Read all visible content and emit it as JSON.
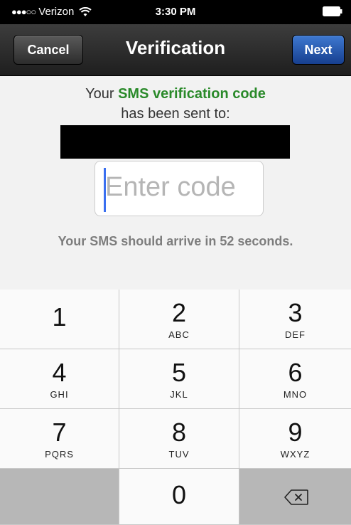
{
  "status": {
    "signal": "●●●○○",
    "carrier": "Verizon",
    "time": "3:30 PM",
    "icons": [
      "wifi-icon",
      "battery-icon"
    ]
  },
  "nav": {
    "cancel_label": "Cancel",
    "title": "Verification",
    "next_label": "Next"
  },
  "message": {
    "line1_prefix": "Your ",
    "line1_highlight": "SMS verification code",
    "line2": "has been sent to:",
    "code_placeholder": "Enter code",
    "code_value": "",
    "arrival_text": "Your SMS should arrive in 52 seconds."
  },
  "keypad": {
    "keys": [
      {
        "digit": "1",
        "letters": ""
      },
      {
        "digit": "2",
        "letters": "ABC"
      },
      {
        "digit": "3",
        "letters": "DEF"
      },
      {
        "digit": "4",
        "letters": "GHI"
      },
      {
        "digit": "5",
        "letters": "JKL"
      },
      {
        "digit": "6",
        "letters": "MNO"
      },
      {
        "digit": "7",
        "letters": "PQRS"
      },
      {
        "digit": "8",
        "letters": "TUV"
      },
      {
        "digit": "9",
        "letters": "WXYZ"
      },
      {
        "digit": "0",
        "letters": ""
      }
    ],
    "delete_icon": "backspace-icon"
  },
  "colors": {
    "highlight": "#2a8a2a",
    "next_button": "#1f4fa8",
    "cursor": "#3a6ff0"
  }
}
